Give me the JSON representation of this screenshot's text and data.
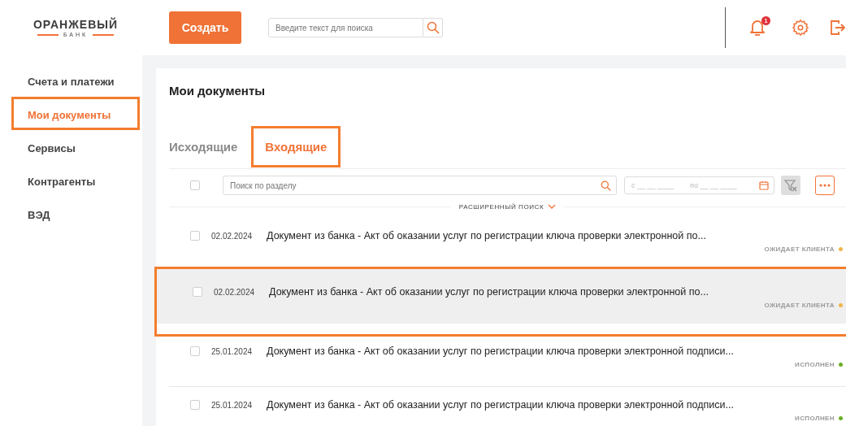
{
  "logo": {
    "name": "ОРАНЖЕВЫЙ",
    "sub": "БАНК"
  },
  "header": {
    "create_button": "Создать",
    "search": {
      "placeholder": "Введите текст для поиска"
    },
    "notifications_badge": "1"
  },
  "sidebar": {
    "items": [
      {
        "label": "Счета и платежи",
        "selected": false
      },
      {
        "label": "Мои документы",
        "selected": true
      },
      {
        "label": "Сервисы",
        "selected": false
      },
      {
        "label": "Контрагенты",
        "selected": false
      },
      {
        "label": "ВЭД",
        "selected": false
      }
    ]
  },
  "page": {
    "title": "Мои документы",
    "tabs": [
      {
        "label": "Исходящие",
        "selected": false
      },
      {
        "label": "Входящие",
        "selected": true
      }
    ],
    "filter": {
      "search_placeholder": "Поиск по разделу",
      "date_from": "с __ __ ____",
      "date_to": "по __ __ ____",
      "select_all_checked": false,
      "advanced_search": "РАСШИРЕННЫЙ ПОИСК"
    },
    "documents": [
      {
        "date": "02.02.2024",
        "title": "Документ из банка - Акт об оказании услуг по регистрации ключа проверки электронной по...",
        "status": "ОЖИДАЕТ КЛИЕНТА",
        "color": "#f0b54a",
        "checked": false,
        "selected": false
      },
      {
        "date": "02.02.2024",
        "title": "Документ из банка - Акт об оказании услуг по регистрации ключа проверки электронной по...",
        "status": "ОЖИДАЕТ КЛИЕНТА",
        "color": "#f0b54a",
        "checked": false,
        "selected": true
      },
      {
        "date": "25.01.2024",
        "title": "Документ из банка - Акт об оказании услуг по регистрации ключа проверки электронной подписи...",
        "status": "ИСПОЛНЕН",
        "color": "#6aae25",
        "checked": false,
        "selected": false
      },
      {
        "date": "25.01.2024",
        "title": "Документ из банка - Акт об оказании услуг по регистрации ключа проверки электронной подписи...",
        "status": "ИСПОЛНЕН",
        "color": "#6aae25",
        "checked": false,
        "selected": false
      }
    ]
  }
}
